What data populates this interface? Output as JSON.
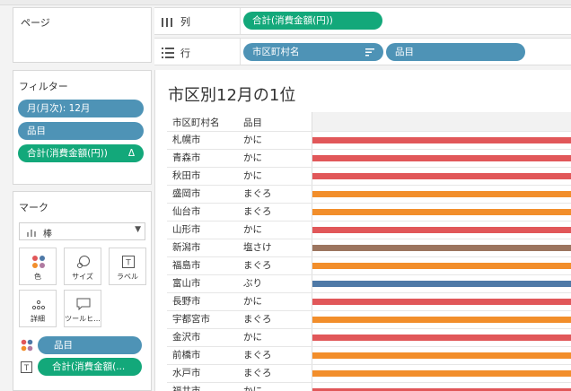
{
  "left_panel": {
    "pages_title": "ページ",
    "filters_title": "フィルター",
    "filters": [
      {
        "label": "月(月次): 12月",
        "color": "blue"
      },
      {
        "label": "品目",
        "color": "blue"
      },
      {
        "label": "合計(消費金額(円))",
        "color": "green",
        "badge": "Δ"
      }
    ],
    "marks_title": "マーク",
    "mark_type": "棒",
    "mark_buttons": [
      {
        "label": "色",
        "icon": "color-dots-icon"
      },
      {
        "label": "サイズ",
        "icon": "size-icon"
      },
      {
        "label": "ラベル",
        "icon": "label-icon"
      },
      {
        "label": "詳細",
        "icon": "detail-icon"
      },
      {
        "label": "ツールヒ...",
        "icon": "tooltip-icon"
      }
    ],
    "mark_fields": [
      {
        "label": "品目",
        "color": "blue",
        "icon": "color-dots-icon"
      },
      {
        "label": "合計(消費金額(...",
        "color": "green",
        "icon": "label-icon"
      }
    ]
  },
  "shelves": {
    "columns_label": "列",
    "columns_pill": "合計(消費金額(円))",
    "rows_label": "行",
    "rows_pills": [
      "市区町村名",
      "品目"
    ]
  },
  "view": {
    "title": "市区別12月の1位",
    "headers": [
      "市区町村名",
      "品目"
    ],
    "colors": {
      "かに": "#e15759",
      "まぐろ": "#f28e2b",
      "塩さけ": "#9c755f",
      "ぶり": "#4e79a7"
    }
  },
  "chart_data": {
    "type": "bar",
    "rows": [
      {
        "city": "札幌市",
        "item": "かに"
      },
      {
        "city": "青森市",
        "item": "かに"
      },
      {
        "city": "秋田市",
        "item": "かに"
      },
      {
        "city": "盛岡市",
        "item": "まぐろ"
      },
      {
        "city": "仙台市",
        "item": "まぐろ"
      },
      {
        "city": "山形市",
        "item": "かに"
      },
      {
        "city": "新潟市",
        "item": "塩さけ"
      },
      {
        "city": "福島市",
        "item": "まぐろ"
      },
      {
        "city": "富山市",
        "item": "ぶり"
      },
      {
        "city": "長野市",
        "item": "かに"
      },
      {
        "city": "宇都宮市",
        "item": "まぐろ"
      },
      {
        "city": "金沢市",
        "item": "かに"
      },
      {
        "city": "前橋市",
        "item": "まぐろ"
      },
      {
        "city": "水戸市",
        "item": "まぐろ"
      },
      {
        "city": "福井市",
        "item": "かに"
      }
    ]
  }
}
